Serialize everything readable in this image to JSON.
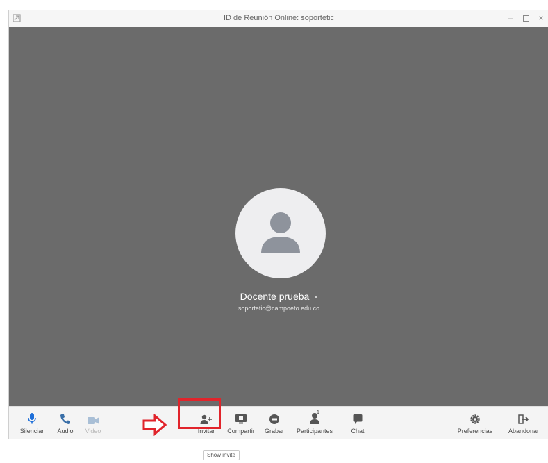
{
  "window": {
    "title": "ID de Reunión Online: soportetic"
  },
  "participant": {
    "name": "Docente prueba",
    "email": "soportetic@campoeto.edu.co"
  },
  "toolbar": {
    "silenciar": "Silenciar",
    "audio": "Audio",
    "video": "Video",
    "invitar": "Invitar",
    "compartir": "Compartir",
    "grabar": "Grabar",
    "participantes": "Participantes",
    "participantes_count": "1",
    "chat": "Chat",
    "preferencias": "Preferencias",
    "abandonar": "Abandonar"
  },
  "tooltip": {
    "text": "Show invite"
  },
  "colors": {
    "stage": "#6b6b6b",
    "accent_blue": "#1e6fd9",
    "highlight_red": "#e1242b"
  },
  "icons": [
    "app-icon",
    "minimize-icon",
    "maximize-icon",
    "close-icon",
    "person-icon",
    "microphone-icon",
    "phone-icon",
    "video-icon",
    "add-person-icon",
    "screen-share-icon",
    "record-icon",
    "participants-icon",
    "chat-icon",
    "gear-icon",
    "exit-icon",
    "arrow-right-icon"
  ]
}
